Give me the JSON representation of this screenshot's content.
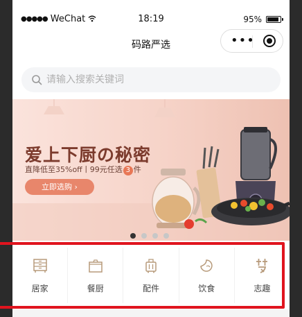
{
  "status_bar": {
    "signal": "●●●●●",
    "carrier": "WeChat",
    "time": "18:19",
    "battery": "95%",
    "battery_level": 0.95
  },
  "nav": {
    "title": "码路严选",
    "capsule_more_icon": "more-dots-icon",
    "capsule_close_icon": "record-close-icon"
  },
  "search": {
    "placeholder": "请输入搜索关键词",
    "icon": "search-icon"
  },
  "banner": {
    "title": "爱上下厨の秘密",
    "subtitle_pre": "直降低至35%off丨99元任选",
    "subtitle_badge": "3",
    "subtitle_post": "件",
    "cta": "立即选购 ›",
    "pages": 4,
    "active_page": 1
  },
  "categories": [
    {
      "label": "居家",
      "icon": "cabinet-icon"
    },
    {
      "label": "餐厨",
      "icon": "pot-icon"
    },
    {
      "label": "配件",
      "icon": "suitcase-icon"
    },
    {
      "label": "饮食",
      "icon": "food-icon"
    },
    {
      "label": "志趣",
      "icon": "hobby-icon"
    }
  ],
  "colors": {
    "highlight": "#e0141e",
    "banner_cta": "#e8866b",
    "banner_title": "#7c3b2d",
    "icon_stroke": "#b79a7a"
  }
}
